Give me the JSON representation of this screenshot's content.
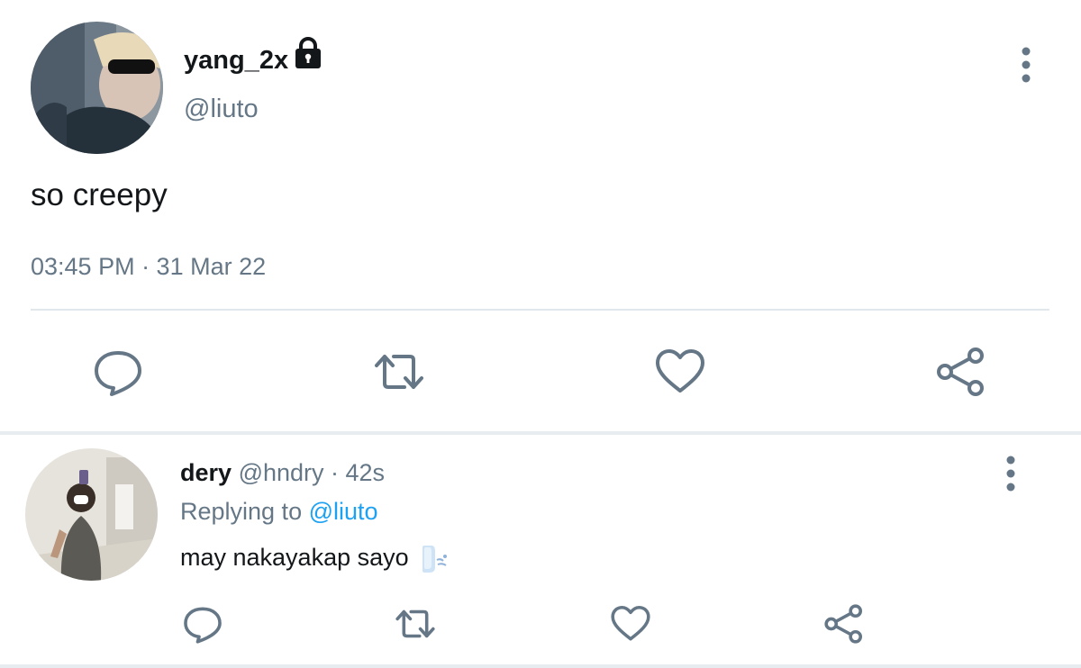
{
  "tweet": {
    "display_name": "yang_2x",
    "handle": "@liuto",
    "text": "so creepy",
    "timestamp": "03:45 PM · 31 Mar 22",
    "icons": {
      "lock": "lock-icon",
      "more": "more-vertical-icon",
      "actions": [
        "reply-icon",
        "retweet-icon",
        "like-icon",
        "share-icon"
      ]
    }
  },
  "reply": {
    "display_name": "dery",
    "meta": "@hndry · 42s",
    "replying_prefix": "Replying to",
    "replying_to": "@liuto",
    "text": "may nakayakap sayo",
    "emoji": "dashing-away-emoji",
    "icons": {
      "more": "more-vertical-icon",
      "actions": [
        "reply-icon",
        "retweet-icon",
        "like-icon",
        "share-icon"
      ]
    }
  },
  "colors": {
    "text_primary": "#14171a",
    "text_secondary": "#657786",
    "mention": "#1da1f2",
    "divider": "#e1e8ed",
    "icon": "#657786"
  }
}
